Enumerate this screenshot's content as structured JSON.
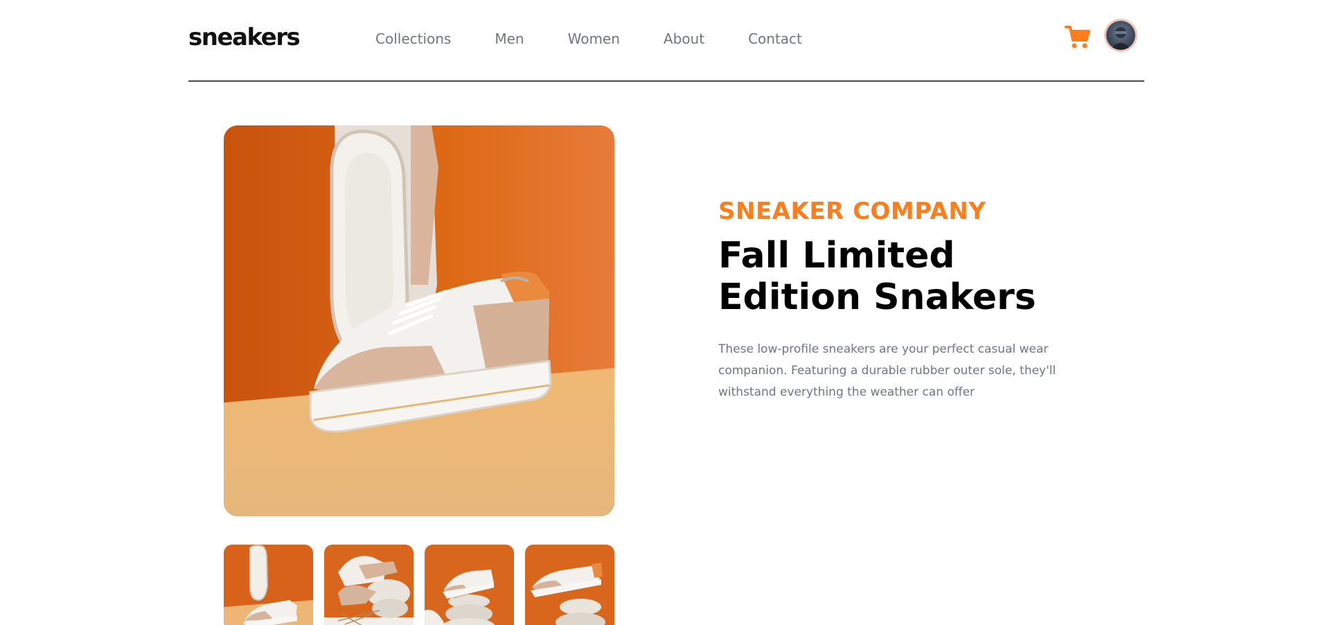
{
  "header": {
    "logo": "sneakers",
    "nav": [
      "Collections",
      "Men",
      "Women",
      "About",
      "Contact"
    ],
    "cart_icon": "cart-icon",
    "avatar_icon": "avatar"
  },
  "gallery": {
    "main_image": "sneaker-product-image-1",
    "thumbnails": [
      "sneaker-thumbnail-1",
      "sneaker-thumbnail-2",
      "sneaker-thumbnail-3",
      "sneaker-thumbnail-4"
    ]
  },
  "product": {
    "company": "SNEAKER COMPANY",
    "title": "Fall Limited Edition Snakers",
    "description": "These low-profile sneakers are your perfect casual wear companion. Featuring a durable rubber outer sole, they'll withstand everything the weather can offer"
  },
  "colors": {
    "accent": "#ff7d1a",
    "text_dark": "#000000",
    "text_muted": "#707580"
  }
}
